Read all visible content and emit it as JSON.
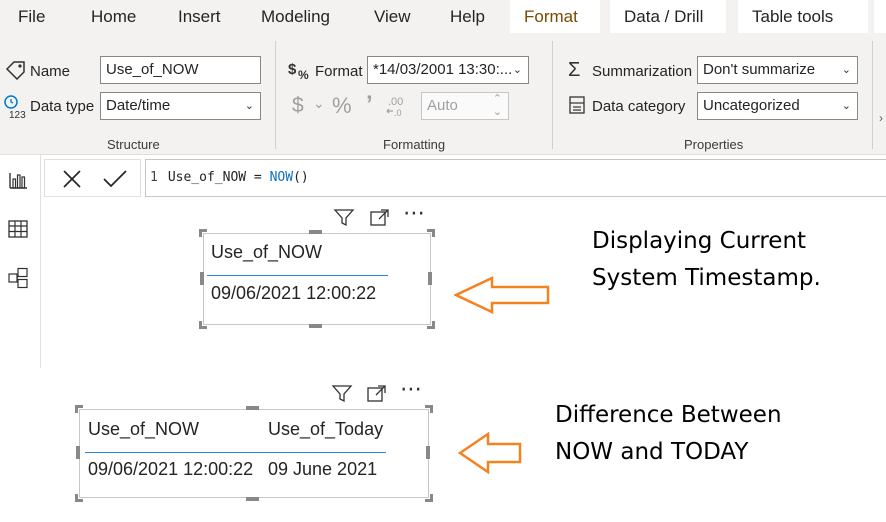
{
  "ribbon_tabs": [
    "File",
    "Home",
    "Insert",
    "Modeling",
    "View",
    "Help"
  ],
  "context_tabs": [
    "Format",
    "Data / Drill",
    "Table tools"
  ],
  "structure": {
    "name_label": "Name",
    "name_value": "Use_of_NOW",
    "datatype_label": "Data type",
    "datatype_value": "Date/time",
    "group_label": "Structure"
  },
  "formatting": {
    "format_label": "Format",
    "format_value": "*14/03/2001 13:30:...",
    "auto_value": "Auto",
    "group_label": "Formatting"
  },
  "properties": {
    "summarization_label": "Summarization",
    "summarization_value": "Don't summarize",
    "category_label": "Data category",
    "category_value": "Uncategorized",
    "group_label": "Properties"
  },
  "formula": {
    "line_number": "1",
    "prefix": "Use_of_NOW = ",
    "function": "NOW",
    "suffix": "()"
  },
  "card1": {
    "header": "Use_of_NOW",
    "value": "09/06/2021 12:00:22"
  },
  "card2": {
    "headers": [
      "Use_of_NOW",
      "Use_of_Today"
    ],
    "values": [
      "09/06/2021 12:00:22",
      "09 June 2021"
    ]
  },
  "annotations": {
    "note1_line1": "Displaying Current",
    "note1_line2": "System Timestamp.",
    "note2_line1": "Difference Between",
    "note2_line2": "NOW and TODAY"
  },
  "colors": {
    "arrow": "#f58220",
    "accent_underline": "#2b88d8",
    "ribbon_bg": "#f3f2f1"
  },
  "icons": [
    "tag-icon",
    "datatype-icon",
    "format-icon",
    "currency-icon",
    "percent-icon",
    "comma-icon",
    "decimal-icon",
    "sigma-icon",
    "category-icon",
    "cancel-icon",
    "commit-icon",
    "report-view-icon",
    "data-view-icon",
    "model-view-icon",
    "filter-icon",
    "focus-mode-icon",
    "more-options-icon",
    "arrow-left-icon"
  ]
}
